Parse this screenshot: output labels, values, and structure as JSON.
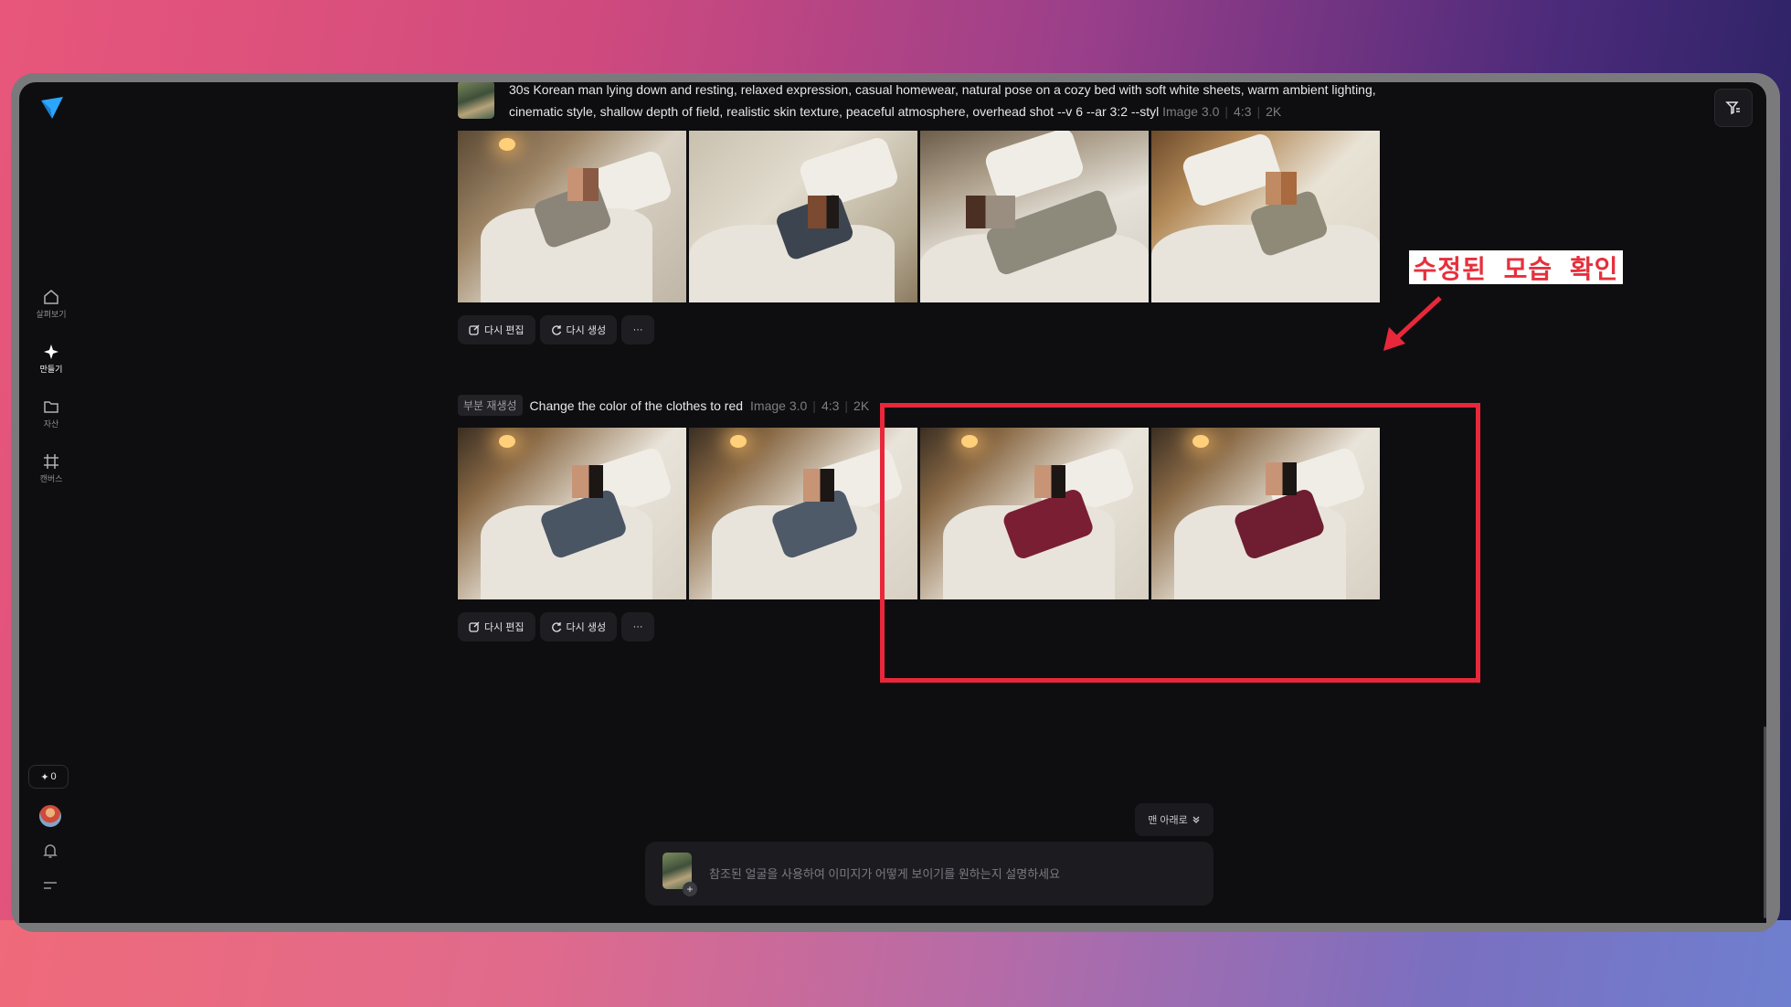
{
  "sidebar": {
    "items": [
      {
        "label": "살펴보기",
        "icon": "home-icon"
      },
      {
        "label": "만들기",
        "icon": "sparkle-icon",
        "active": true
      },
      {
        "label": "자산",
        "icon": "folder-icon"
      },
      {
        "label": "캔버스",
        "icon": "canvas-icon"
      }
    ],
    "credits": "0"
  },
  "generation1": {
    "prompt": "30s Korean man lying down and resting, relaxed expression, casual homewear, natural pose on a cozy bed with soft white sheets, warm ambient lighting, cinematic style, shallow depth of field, realistic skin texture, peaceful atmosphere, overhead shot --v 6 --ar 3:2 --styl",
    "model": "Image 3.0",
    "ratio": "4:3",
    "resolution": "2K"
  },
  "generation2": {
    "badge": "부분 재생성",
    "prompt": "Change the color of the clothes to red",
    "model": "Image 3.0",
    "ratio": "4:3",
    "resolution": "2K"
  },
  "actions": {
    "edit_label": "다시 편집",
    "regenerate_label": "다시 생성",
    "more_label": "···"
  },
  "scroll_bottom_label": "맨 아래로",
  "composer": {
    "placeholder": "참조된 얼굴을 사용하여 이미지가 어떻게 보이기를 원하는지 설명하세요"
  },
  "annotation": {
    "callout_text": "수정된 모습 확인",
    "color": "#e8283a"
  },
  "shirt_colors": {
    "row1": [
      "#8b8478",
      "#3c4450",
      "#8d8a7c",
      "#8f8a78"
    ],
    "row2": [
      "#4a5564",
      "#4e5a68",
      "#7a1f33",
      "#6e1e30"
    ]
  }
}
